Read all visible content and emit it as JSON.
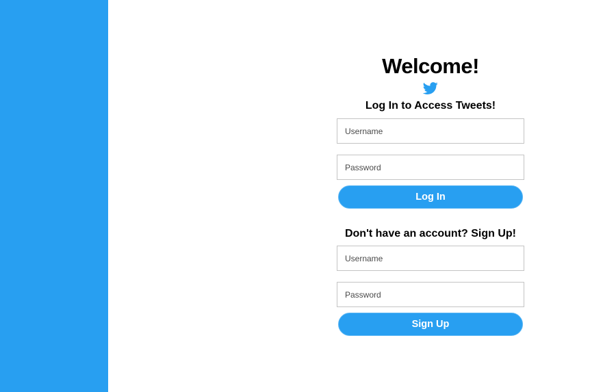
{
  "brand": {
    "accent": "#289ff1",
    "icon": "twitter-bird-icon"
  },
  "welcome": {
    "title": "Welcome!"
  },
  "login": {
    "heading": "Log In to Access Tweets!",
    "username_placeholder": "Username",
    "password_placeholder": "Password",
    "button_label": "Log In"
  },
  "signup": {
    "heading": "Don't have an account? Sign Up!",
    "username_placeholder": "Username",
    "password_placeholder": "Password",
    "button_label": "Sign Up"
  }
}
